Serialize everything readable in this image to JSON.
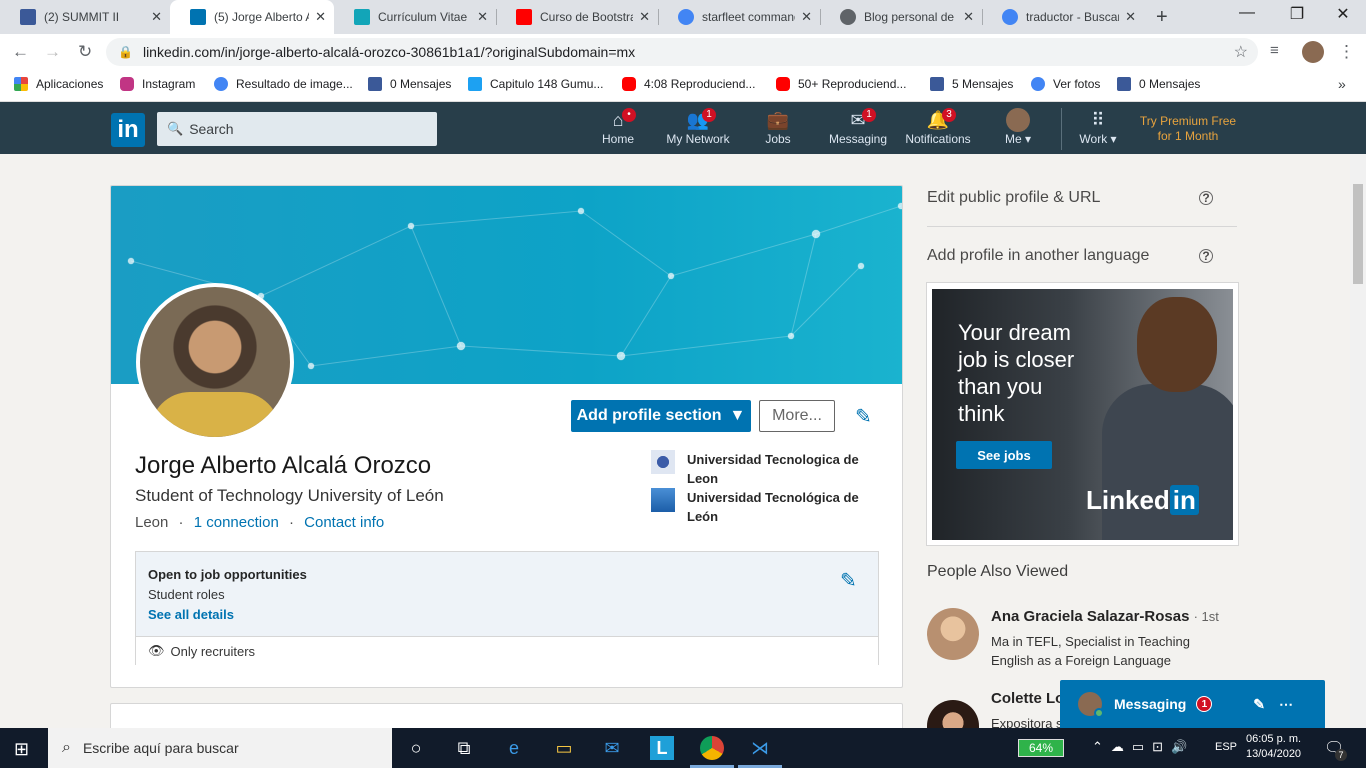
{
  "browser": {
    "tabs": [
      {
        "title": "(2) SUMMIT II",
        "icon": "facebook-icon",
        "color": "#3b5998"
      },
      {
        "title": "(5) Jorge Alberto A",
        "icon": "linkedin-icon",
        "color": "#0073b1"
      },
      {
        "title": "Currículum Vitae",
        "icon": "profile-card-icon",
        "color": "#12a5b8"
      },
      {
        "title": "Curso de Bootstrap",
        "icon": "youtube-icon",
        "color": "#ff0000"
      },
      {
        "title": "starfleet command",
        "icon": "google-icon",
        "color": "#4285f4"
      },
      {
        "title": "Blog personal de J",
        "icon": "globe-icon",
        "color": "#5f6368"
      },
      {
        "title": "traductor - Buscar",
        "icon": "google-icon",
        "color": "#4285f4"
      }
    ],
    "url": "linkedin.com/in/jorge-alberto-alcalá-orozco-30861b1a1/?originalSubdomain=mx",
    "bookmarks": [
      {
        "label": "Aplicaciones",
        "icon": "apps-grid-icon",
        "color": "#e8453c"
      },
      {
        "label": "Instagram",
        "icon": "instagram-icon",
        "color": "#c13584"
      },
      {
        "label": "Resultado de image...",
        "icon": "google-icon",
        "color": "#4285f4"
      },
      {
        "label": "0 Mensajes",
        "icon": "facebook-icon",
        "color": "#3b5998"
      },
      {
        "label": "Capitulo 148 Gumu...",
        "icon": "bookmark-icon",
        "color": "#1da1f2"
      },
      {
        "label": "4:08 Reproduciend...",
        "icon": "youtube-icon",
        "color": "#ff0000"
      },
      {
        "label": "50+ Reproduciend...",
        "icon": "youtube-icon",
        "color": "#ff0000"
      },
      {
        "label": "5 Mensajes",
        "icon": "facebook-icon",
        "color": "#3b5998"
      },
      {
        "label": "Ver fotos",
        "icon": "google-icon",
        "color": "#4285f4"
      },
      {
        "label": "0 Mensajes",
        "icon": "facebook-icon",
        "color": "#3b5998"
      }
    ]
  },
  "linkedin": {
    "logo": "in",
    "search_placeholder": "Search",
    "nav": [
      {
        "label": "Home",
        "icon": "home-icon",
        "badge": "•"
      },
      {
        "label": "My Network",
        "icon": "network-icon",
        "badge": "1"
      },
      {
        "label": "Jobs",
        "icon": "briefcase-icon",
        "badge": ""
      },
      {
        "label": "Messaging",
        "icon": "messaging-icon",
        "badge": "1"
      },
      {
        "label": "Notifications",
        "icon": "bell-icon",
        "badge": "3"
      },
      {
        "label": "Me ▾",
        "icon": "avatar",
        "badge": ""
      },
      {
        "label": "Work ▾",
        "icon": "grid-icon",
        "badge": ""
      }
    ],
    "premium_line1": "Try Premium Free",
    "premium_line2": "for 1 Month",
    "accent": "#0073b1",
    "navbar_color": "#283e4a"
  },
  "profile": {
    "add_section": "Add profile section",
    "more": "More...",
    "name": "Jorge Alberto Alcalá Orozco",
    "headline": "Student of Technology University of León",
    "location": "Leon",
    "connections": "1 connection",
    "contact": "Contact info",
    "education": [
      {
        "line1": "Universidad Tecnologica de",
        "line2": "Leon"
      },
      {
        "line1": "Universidad Tecnológica de",
        "line2": "León"
      }
    ],
    "job": {
      "title": "Open to job opportunities",
      "roles": "Student roles",
      "details": "See all details",
      "visibility": "Only recruiters"
    }
  },
  "sidebar": {
    "edit_public": "Edit public profile & URL",
    "add_language": "Add profile in another language",
    "ad": {
      "line1": "Your dream",
      "line2": "job is closer",
      "line3": "than you",
      "line4": "think",
      "button": "See jobs",
      "brand": "Linked",
      "brand_in": "in"
    },
    "people_title": "People Also Viewed",
    "people": [
      {
        "name": "Ana Graciela Salazar-Rosas",
        "degree": "· 1st",
        "headline": "Ma in TEFL, Specialist in Teaching English as a Foreign Language"
      },
      {
        "name": "Colette Lo",
        "degree": "",
        "headline": "Expositora s"
      }
    ]
  },
  "messaging": {
    "label": "Messaging",
    "badge": "1"
  },
  "taskbar": {
    "search_placeholder": "Escribe aquí para buscar",
    "battery": "64%",
    "lang": "ESP",
    "time": "06:05 p. m.",
    "date": "13/04/2020",
    "notif_count": "7"
  }
}
